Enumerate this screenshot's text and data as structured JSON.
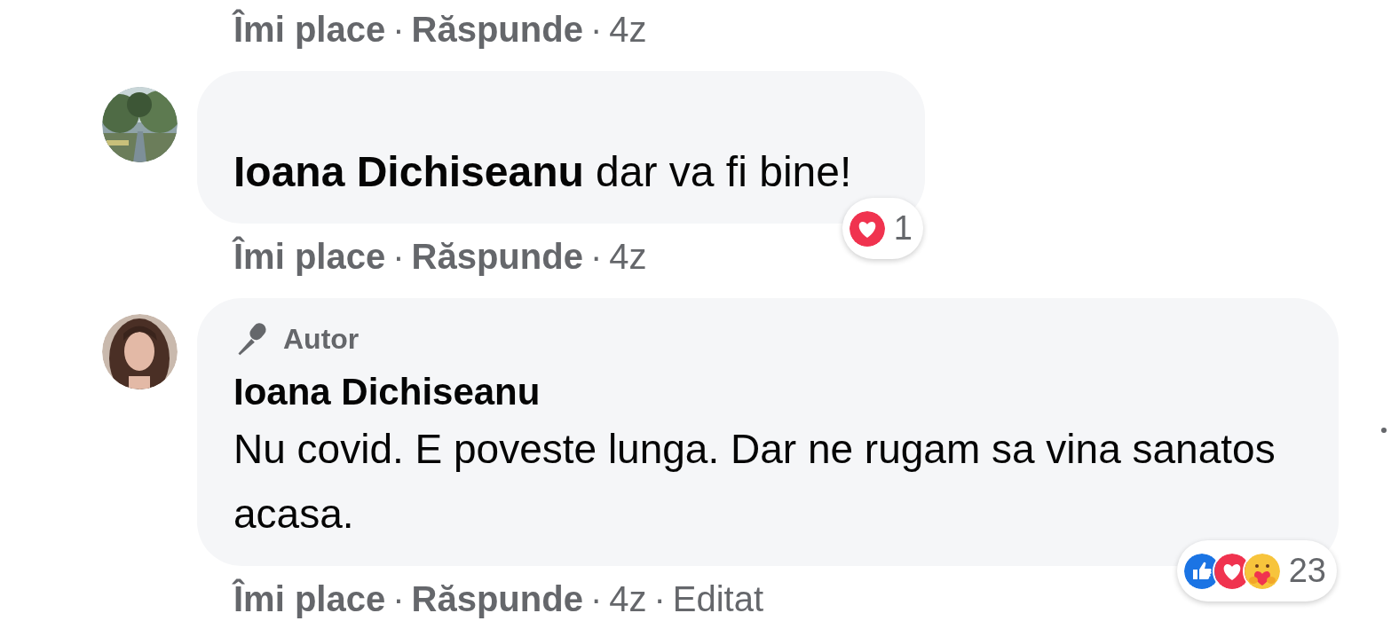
{
  "top_actions": {
    "actions": [
      "Îmi place",
      "Răspunde"
    ],
    "separator": "·",
    "time": "4z"
  },
  "comments": [
    {
      "avatar": {
        "kind": "picture"
      },
      "text": "**Ioana Dichiseanu** dar va fi bine!",
      "reactions": {
        "types": [
          {
            "kind": "love"
          }
        ],
        "count": "1"
      },
      "actions": [
        "Îmi place",
        "Răspunde"
      ],
      "separator": "·",
      "time": "4z"
    },
    {
      "avatar": {
        "kind": "picture"
      },
      "badge": "Autor",
      "author": "Ioana Dichiseanu",
      "text": "Nu covid. E poveste lunga. Dar ne rugam sa vina sanatos acasa.",
      "reactions": {
        "types": [
          {
            "kind": "like"
          },
          {
            "kind": "love"
          },
          {
            "kind": "care"
          }
        ],
        "count": "23"
      },
      "actions": [
        "Îmi place",
        "Răspunde"
      ],
      "separator": "·",
      "time": "4z",
      "edited": "Editat"
    }
  ]
}
